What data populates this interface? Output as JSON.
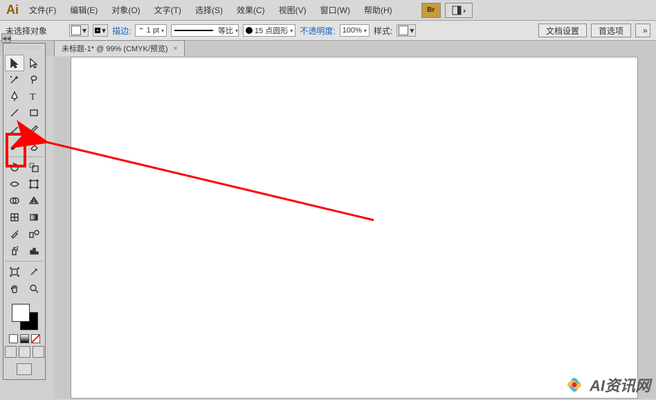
{
  "app": {
    "logo": "Ai"
  },
  "menu": {
    "file": "文件(F)",
    "edit": "编辑(E)",
    "object": "对象(O)",
    "type": "文字(T)",
    "select": "选择(S)",
    "effect": "效果(C)",
    "view": "视图(V)",
    "window": "窗口(W)",
    "help": "帮助(H)",
    "br_badge": "Br"
  },
  "control": {
    "no_selection": "未选择对象",
    "stroke_label": "描边:",
    "stroke_value": "1 pt",
    "uniform_label": "等比",
    "style_value": "15 点圆形",
    "opacity_label": "不透明度:",
    "opacity_value": "100%",
    "style_label": "样式:",
    "doc_setup": "文档设置",
    "preferences": "首选项",
    "arrows": "»"
  },
  "tab": {
    "title": "未标题-1* @ 99% (CMYK/预览)",
    "close": "×"
  },
  "tooltips": {
    "selection": "选择",
    "direct": "直接选择",
    "wand": "魔棒",
    "lasso": "套索",
    "pen": "钢笔",
    "type": "文字",
    "line": "直线段",
    "rect": "矩形",
    "brush": "画笔",
    "pencil": "铅笔",
    "blob": "斑点画笔",
    "eraser": "橡皮擦",
    "rotate": "旋转",
    "scale": "比例缩放",
    "width": "宽度",
    "free": "自由变换",
    "shapebuilder": "形状生成器",
    "perspective": "透视网格",
    "mesh": "网格",
    "gradient": "渐变",
    "eyedropper": "吸管",
    "blend": "混合",
    "spray": "符号喷枪",
    "graph": "柱形图",
    "artboard": "画板",
    "slice": "切片",
    "hand": "抓手",
    "zoom": "缩放"
  },
  "annotations": {
    "highlight_desc": "画笔工具高亮"
  },
  "watermark": {
    "text": "AI资讯网"
  }
}
